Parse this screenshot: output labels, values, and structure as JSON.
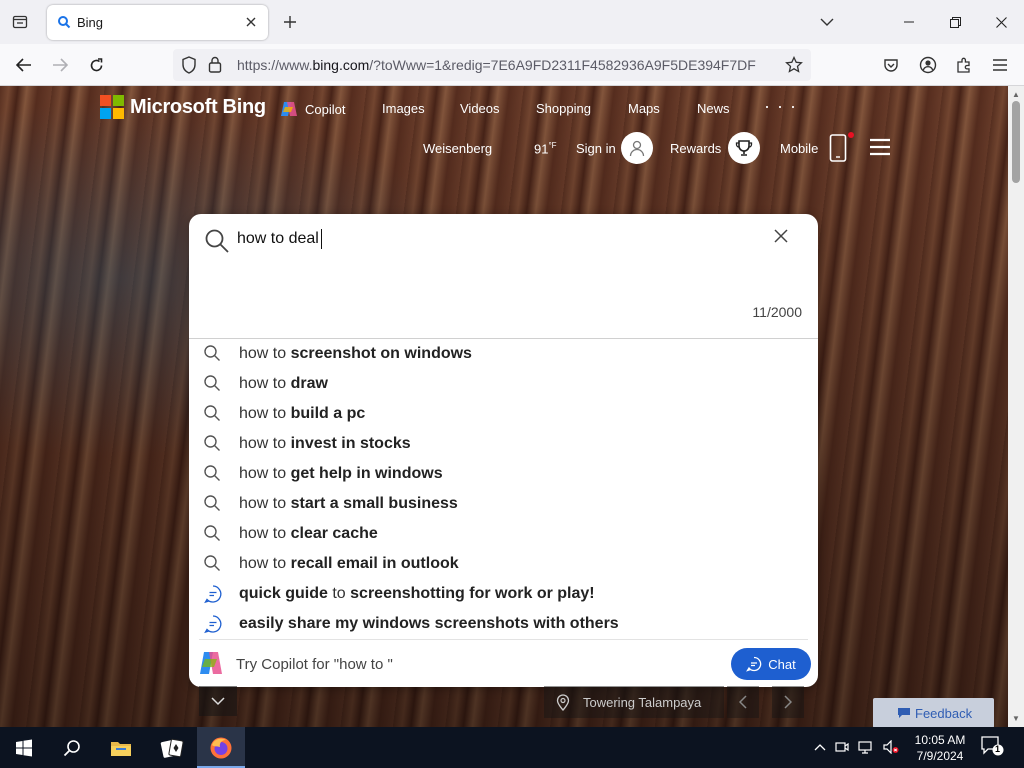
{
  "browser": {
    "tab_title": "Bing",
    "url_prefix": "https://www.",
    "url_domain": "bing.com",
    "url_rest": "/?toWww=1&redig=7E6A9FD2311F4582936A9F5DE394F7DF"
  },
  "bing": {
    "logo_text": "Microsoft Bing",
    "nav": {
      "copilot": "Copilot",
      "images": "Images",
      "videos": "Videos",
      "shopping": "Shopping",
      "maps": "Maps",
      "news": "News",
      "more": "· · ·"
    },
    "header": {
      "location": "Weisenberg",
      "temperature": "91",
      "temperature_unit": "°F",
      "sign_in": "Sign in",
      "rewards": "Rewards",
      "mobile": "Mobile"
    }
  },
  "search": {
    "query": "how to deal",
    "char_count": "11/2000",
    "suggestions": [
      {
        "type": "search",
        "prefix": "how to ",
        "bold": "screenshot on windows",
        "suffix": ""
      },
      {
        "type": "search",
        "prefix": "how to ",
        "bold": "draw",
        "suffix": ""
      },
      {
        "type": "search",
        "prefix": "how to ",
        "bold": "build a pc",
        "suffix": ""
      },
      {
        "type": "search",
        "prefix": "how to ",
        "bold": "invest in stocks",
        "suffix": ""
      },
      {
        "type": "search",
        "prefix": "how to ",
        "bold": "get help in windows",
        "suffix": ""
      },
      {
        "type": "search",
        "prefix": "how to ",
        "bold": "start a small business",
        "suffix": ""
      },
      {
        "type": "search",
        "prefix": "how to ",
        "bold": "clear cache",
        "suffix": ""
      },
      {
        "type": "search",
        "prefix": "how to ",
        "bold": "recall email in outlook",
        "suffix": ""
      },
      {
        "type": "chat",
        "prefix": "",
        "bold": "quick guide",
        "mid": " to ",
        "bold2": "screenshotting for work or play!"
      },
      {
        "type": "chat",
        "prefix": "",
        "bold": "easily share my windows screenshots with others",
        "mid": "",
        "bold2": ""
      }
    ],
    "copilot_prompt": "Try Copilot for \"how to \"",
    "chat_label": "Chat"
  },
  "page": {
    "image_caption": "Towering Talampaya",
    "feedback_label": "Feedback"
  },
  "taskbar": {
    "time": "10:05 AM",
    "date": "7/9/2024",
    "notification_count": "1"
  },
  "colors": {
    "chat_button": "#1e5fd0",
    "taskbar": "#0c1320",
    "ms_red": "#f25022",
    "ms_green": "#7fba00",
    "ms_blue": "#00a4ef",
    "ms_yellow": "#ffb900"
  }
}
